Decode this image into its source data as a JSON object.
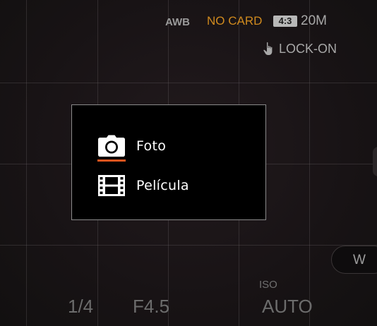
{
  "status_bar": {
    "white_balance": "AWB",
    "card_status": "NO CARD",
    "aspect_ratio": "4:3",
    "resolution": "20M",
    "lock_status": "LOCK-ON"
  },
  "mode_menu": {
    "items": [
      {
        "label": "Foto",
        "icon": "camera-icon",
        "selected": true
      },
      {
        "label": "Película",
        "icon": "film-icon",
        "selected": false
      }
    ],
    "selection_color": "#e2541e"
  },
  "zoom": {
    "label": "W"
  },
  "exposure": {
    "shutter_speed": "1/4",
    "aperture": "F4.5",
    "iso_label": "ISO",
    "iso_value": "AUTO"
  },
  "colors": {
    "card_status": "#d08a1e",
    "background": "#1a1416"
  }
}
